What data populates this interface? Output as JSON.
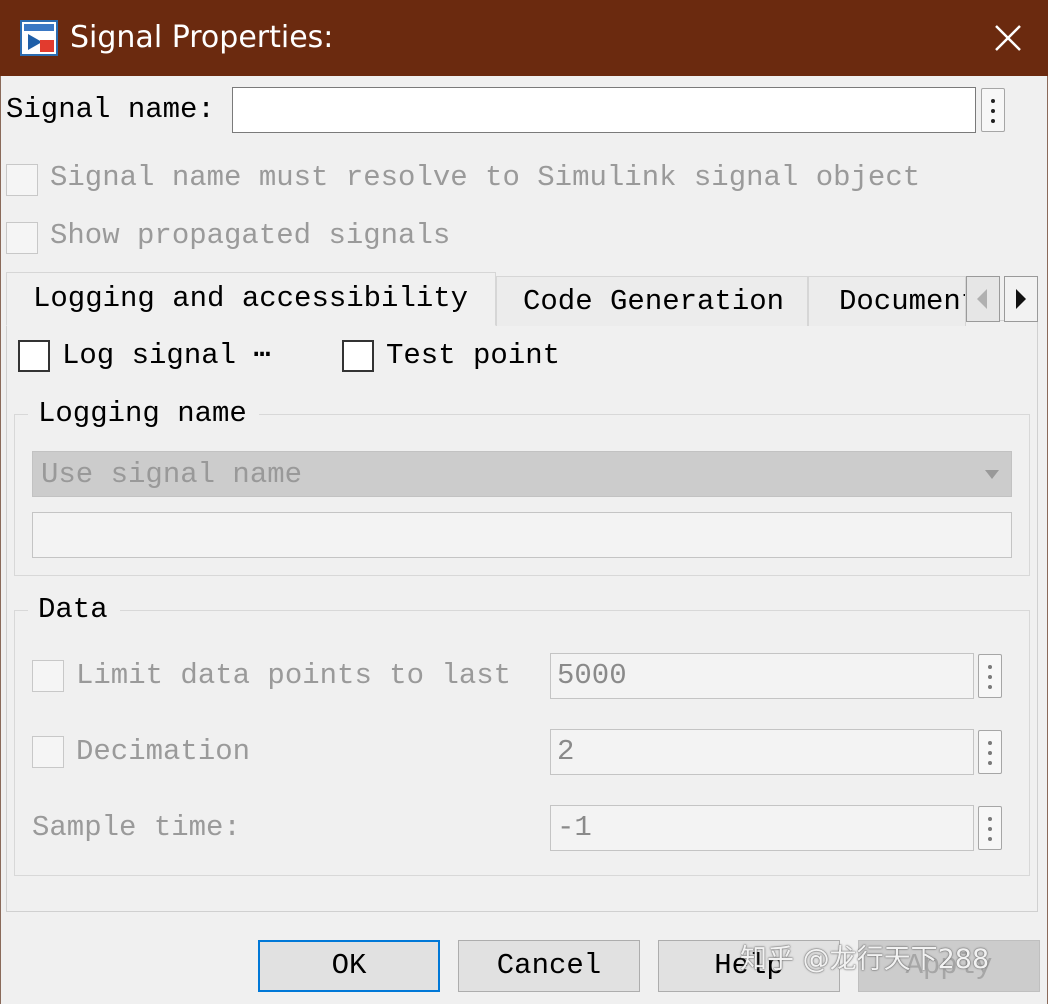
{
  "window": {
    "title": "Signal Properties:",
    "icon": "simulink-block-icon",
    "close_icon": "close-icon"
  },
  "signal_name": {
    "label": "Signal name:",
    "value": ""
  },
  "options": {
    "resolve_label": "Signal name must resolve to Simulink signal object",
    "propagated_label": "Show propagated signals"
  },
  "tabs": [
    {
      "label": "Logging and accessibility",
      "active": true
    },
    {
      "label": "Code Generation",
      "active": false
    },
    {
      "label": "Document",
      "active": false
    }
  ],
  "logging": {
    "log_signal_label": "Log signal ⋯",
    "test_point_label": "Test point",
    "logging_name_legend": "Logging name",
    "mode_value": "Use signal name",
    "name_value": ""
  },
  "data_group": {
    "legend": "Data",
    "limit_label": "Limit data points to last",
    "limit_value": "5000",
    "decimation_label": "Decimation",
    "decimation_value": "2",
    "sample_time_label": "Sample time:",
    "sample_time_value": "-1"
  },
  "buttons": {
    "ok": "OK",
    "cancel": "Cancel",
    "help": "Help",
    "apply": "Apply"
  },
  "watermark": "知乎 @龙行天下288",
  "colors": {
    "titlebar": "#6b2a0f",
    "default_button_border": "#0078d7"
  }
}
